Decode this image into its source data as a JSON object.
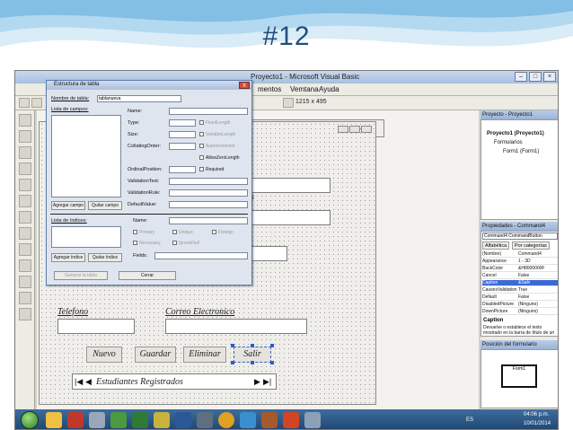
{
  "slide": {
    "title": "#12"
  },
  "ide": {
    "window_title": "Proyecto1 - Microsoft Visual Basic",
    "menu_partial": [
      "mentos",
      "Vemtana",
      "Ayuda"
    ],
    "size_readout": "1215 x 495"
  },
  "form": {
    "fragment_text": "os",
    "labels": {
      "telefono": "Telefono",
      "correo": "Correo Electronico"
    },
    "buttons": {
      "nuevo": "Nuevo",
      "guardar": "Guardar",
      "eliminar": "Eliminar",
      "salir": "Salir"
    },
    "navigator": {
      "caption": "Estudiantes  Registrados",
      "first": "|◀",
      "prev": "◀",
      "next": "▶",
      "last": "▶|"
    }
  },
  "dialog": {
    "title": "Estructura de tabla",
    "close": "X",
    "table_name_label": "Nombre de tabla:",
    "table_name_value": "tablanueva",
    "fields_list_label": "Lista de campos:",
    "field_props": {
      "name": "Name:",
      "type": "Type:",
      "size": "Size:",
      "collating_order": "CollatingOrder:",
      "ordinal_position": "OrdinalPosition:",
      "validation_text": "ValidationText:",
      "validation_rule": "ValidationRule:",
      "default_value": "DefaultValue:"
    },
    "field_checks": {
      "fixed_length": "FixedLength",
      "variable_length": "VariableLength",
      "auto_increment": "AutoIncrement",
      "allow_zero_length": "AllowZeroLength",
      "required": "Required"
    },
    "add_field_button": "Agregar campo",
    "remove_field_button": "Quitar campo",
    "index_list_label": "Lista de índices:",
    "index_name_label": "Name:",
    "index_checks": {
      "primary": "Primary",
      "unique": "Unique",
      "foreign": "Foreign",
      "necessary": "Necessary",
      "ignore_null": "IgnoreNull"
    },
    "index_fields_label": "Fields:",
    "add_index_button": "Agregar índice",
    "remove_index_button": "Quitar índice",
    "build_table_button": "Generar la tabla",
    "close_button": "Cerrar"
  },
  "project_panel": {
    "title": "Proyecto - Proyecto1",
    "tree": [
      "Proyecto1 (Proyecto1)",
      "Formularios",
      "Form1 (Form1)"
    ]
  },
  "properties_panel": {
    "title": "Propiedades - Command4",
    "object": "Command4 CommandButton",
    "tabs": [
      "Alfabética",
      "Por categorías"
    ],
    "rows": [
      {
        "name": "(Nombre)",
        "value": "Command4"
      },
      {
        "name": "Appearance",
        "value": "1 - 3D"
      },
      {
        "name": "BackColor",
        "value": "&H8000000F"
      },
      {
        "name": "Cancel",
        "value": "False"
      },
      {
        "name": "Caption",
        "value": "&Salir"
      },
      {
        "name": "CausesValidation",
        "value": "True"
      },
      {
        "name": "Default",
        "value": "False"
      },
      {
        "name": "DisabledPicture",
        "value": "(Ninguno)"
      },
      {
        "name": "DownPicture",
        "value": "(Ninguno)"
      }
    ],
    "selected_row": "Caption",
    "desc_title": "Caption",
    "desc_text": "Devuelve o establece el texto mostrado en la barra de título de un"
  },
  "layout_panel": {
    "title": "Posición del formulario",
    "mini_form": "Form1"
  },
  "taskbar": {
    "lang": "ES",
    "time": "04:06 p.m.",
    "date": "10/01/2014"
  },
  "colors": {
    "accent": "#1f4f7a",
    "taskbar": "#1f456f",
    "selection": "#3a6ad6"
  }
}
